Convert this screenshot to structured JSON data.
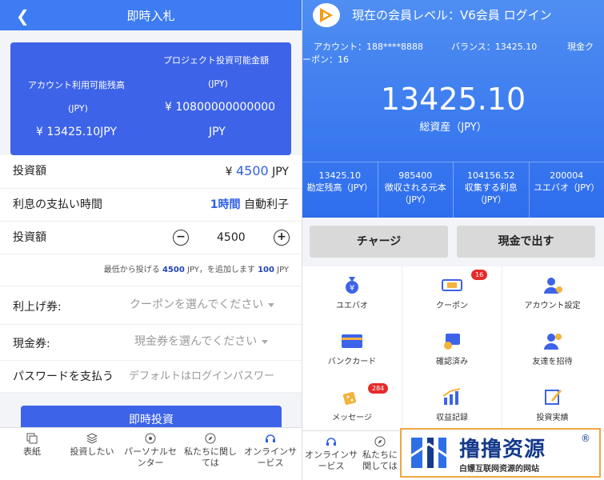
{
  "left": {
    "header_title": "即時入札",
    "back_icon": "chevron-left-icon",
    "card": {
      "available_label": "アカウント利用可能残高",
      "available_unit": "(JPY)",
      "available_value": "¥ 13425.10JPY",
      "project_label": "プロジェクト投資可能金額",
      "project_unit": "(JPY)",
      "project_value": "¥ 10800000000000",
      "project_value_unit": "JPY"
    },
    "investment_amount_label": "投資額",
    "investment_amount_prefix": "¥",
    "investment_amount_value": "4500",
    "investment_amount_unit": "JPY",
    "interest_label": "利息の支払い時間",
    "interest_value": "1時間",
    "interest_type": "自動利子",
    "stepper_label": "投資額",
    "stepper_minus": "−",
    "stepper_value": "4500",
    "stepper_plus": "+",
    "hint_prefix": "最低から投げる",
    "hint_min": "4500",
    "hint_mid": "JPY，を追加します",
    "hint_step": "100",
    "hint_suffix": "JPY",
    "coupon_label": "利上げ券:",
    "coupon_placeholder": "クーポンを選んでください",
    "cash_label": "現金券:",
    "cash_placeholder": "現金券を選んでください",
    "password_label": "パスワードを支払う",
    "password_placeholder": "デフォルトはログインパスワー",
    "submit_label": "即時投資",
    "nav": [
      {
        "label": "表紙",
        "icon": "copy-icon"
      },
      {
        "label": "投資したい",
        "icon": "layers-icon"
      },
      {
        "label": "パーソナルセンター",
        "icon": "circle-target-icon"
      },
      {
        "label": "私たちに関しては",
        "icon": "compass-icon"
      },
      {
        "label": "オンラインサービス",
        "icon": "headset-icon"
      }
    ]
  },
  "right": {
    "title": "現在の会員レベル：V6会員  ログイン",
    "account_text": "アカウント：188****8888",
    "balance_text": "バランス：13425.10",
    "coupon_text_a": "現金ク",
    "coupon_text_b": "ーポン：16",
    "total_assets": "13425.10",
    "total_label": "総資産（JPY）",
    "stats": [
      {
        "value": "13425.10",
        "label": "勘定残高（JPY）"
      },
      {
        "value": "985400",
        "label": "徴収される元本（JPY）"
      },
      {
        "value": "104156.52",
        "label": "収集する利息（JPY）"
      },
      {
        "value": "200004",
        "label": "ユエバオ（JPY）"
      }
    ],
    "charge_button": "チャージ",
    "withdraw_button": "現金で出す",
    "grid": [
      {
        "label": "ユエバオ",
        "icon": "money-bag-icon",
        "badge": ""
      },
      {
        "label": "クーポン",
        "icon": "ticket-icon",
        "badge": "16"
      },
      {
        "label": "アカウント設定",
        "icon": "user-settings-icon",
        "badge": ""
      },
      {
        "label": "バンクカード",
        "icon": "bank-card-icon",
        "badge": ""
      },
      {
        "label": "確認済み",
        "icon": "verified-icon",
        "badge": ""
      },
      {
        "label": "友達を招待",
        "icon": "invite-friend-icon",
        "badge": ""
      },
      {
        "label": "メッセージ",
        "icon": "dice-icon",
        "badge": "284"
      },
      {
        "label": "収益記録",
        "icon": "chart-icon",
        "badge": ""
      },
      {
        "label": "投資実績",
        "icon": "edit-icon",
        "badge": ""
      }
    ],
    "nav": [
      {
        "label": "オンラインサービス",
        "icon": "headset-icon"
      },
      {
        "label": "私たちに関しては",
        "icon": "compass-icon"
      }
    ]
  },
  "watermark": {
    "title": "撸撸资源",
    "subtitle": "白嫖互联网资源的网站",
    "registered": "®"
  },
  "colors": {
    "primary": "#3d63e8",
    "header": "#3d7cf2",
    "badge": "#e62b2b"
  }
}
